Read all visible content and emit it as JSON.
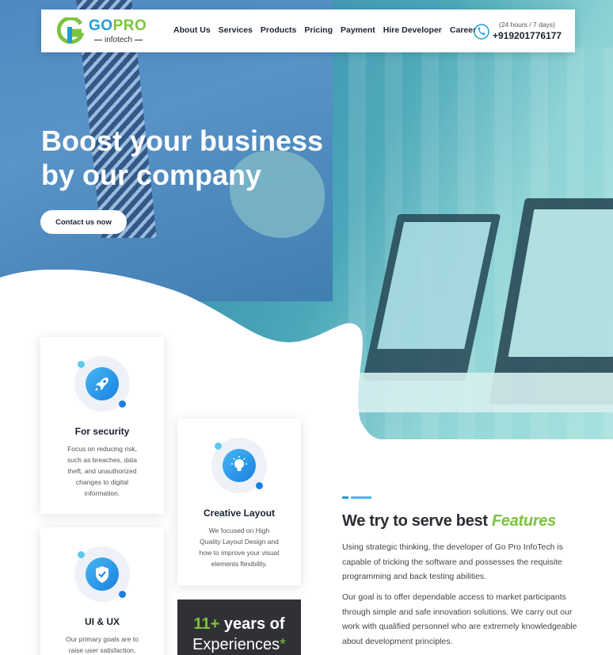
{
  "header": {
    "logo": {
      "brand_a": "GO",
      "brand_b": "PRO",
      "sub": "infotech"
    },
    "nav": [
      "About Us",
      "Services",
      "Products",
      "Pricing",
      "Payment",
      "Hire Developer",
      "Career"
    ],
    "phone": {
      "hours": "(24 hours / 7 days)",
      "number": "+919201776177"
    }
  },
  "hero": {
    "title_line1": "Boost your business",
    "title_line2": "by our company",
    "cta_label": "Contact us now"
  },
  "cards": [
    {
      "icon": "rocket-icon",
      "title": "For security",
      "text": "Focus on reducing risk, such as breaches, data theft, and unauthorized changes to digital information."
    },
    {
      "icon": "lightbulb-icon",
      "title": "Creative Layout",
      "text": "We focused on High Quality Layout Design and how to improve your visual elements flexibility."
    },
    {
      "icon": "shield-check-icon",
      "title": "UI & UX",
      "text": "Our primary goals are to raise user satisfaction,"
    }
  ],
  "years": {
    "number": "11+",
    "word": "years of",
    "line2": "Experiences",
    "star": "*"
  },
  "features": {
    "title_a": "We try to serve best",
    "title_b": "Features",
    "para1": "Using strategic thinking, the developer of Go Pro InfoTech is capable of tricking the software and possesses the requisite programming and back testing abilities.",
    "para2": "Our goal is to offer dependable access to market participants through simple and safe innovation solutions. We carry out our work with qualified personnel who are extremely knowledgeable about development principles."
  },
  "colors": {
    "accent_green": "#7cc33e",
    "accent_blue": "#1e9bd7",
    "dark": "#1b2230"
  }
}
